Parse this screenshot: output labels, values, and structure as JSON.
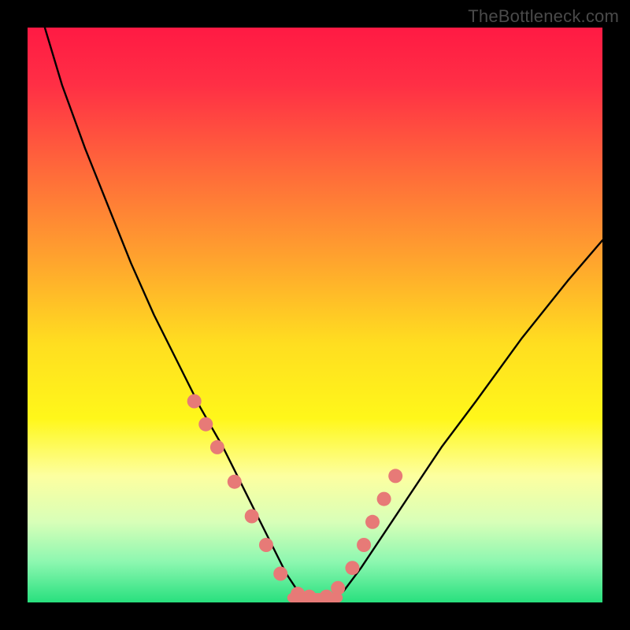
{
  "watermark": "TheBottleneck.com",
  "chart_data": {
    "type": "line",
    "title": "",
    "xlabel": "",
    "ylabel": "",
    "xlim": [
      0,
      100
    ],
    "ylim": [
      0,
      100
    ],
    "grid": false,
    "legend": false,
    "background_gradient": {
      "stops": [
        {
          "offset": 0.0,
          "color": "#ff1a44"
        },
        {
          "offset": 0.1,
          "color": "#ff2f45"
        },
        {
          "offset": 0.25,
          "color": "#ff6a3a"
        },
        {
          "offset": 0.4,
          "color": "#ffa22e"
        },
        {
          "offset": 0.55,
          "color": "#ffde20"
        },
        {
          "offset": 0.68,
          "color": "#fff71a"
        },
        {
          "offset": 0.78,
          "color": "#fdffa0"
        },
        {
          "offset": 0.86,
          "color": "#d8ffb8"
        },
        {
          "offset": 0.93,
          "color": "#8cf7b0"
        },
        {
          "offset": 1.0,
          "color": "#28e07e"
        }
      ]
    },
    "series": [
      {
        "name": "bottleneck-curve",
        "stroke": "#000000",
        "type": "line",
        "x": [
          3,
          6,
          10,
          14,
          18,
          22,
          26,
          30,
          34,
          37,
          40,
          42.5,
          45,
          47,
          49,
          53,
          55,
          58,
          62,
          66,
          72,
          78,
          86,
          94,
          100
        ],
        "y": [
          100,
          90,
          79,
          69,
          59,
          50,
          42,
          34,
          27,
          21,
          15,
          10,
          5,
          2,
          0.5,
          0.5,
          2,
          6,
          12,
          18,
          27,
          35,
          46,
          56,
          63
        ]
      },
      {
        "name": "curve-markers",
        "type": "scatter",
        "marker_color": "#e77a77",
        "marker_radius": 9,
        "x": [
          29,
          31,
          33,
          36,
          39,
          41.5,
          44,
          47,
          49,
          52,
          54,
          56.5,
          58.5,
          60,
          62,
          64
        ],
        "y": [
          35,
          31,
          27,
          21,
          15,
          10,
          5,
          1.5,
          1,
          1,
          2.5,
          6,
          10,
          14,
          18,
          22
        ]
      },
      {
        "name": "floor-segment",
        "type": "line",
        "stroke": "#e77a77",
        "stroke_width": 12,
        "x": [
          46,
          54
        ],
        "y": [
          0.8,
          0.8
        ]
      }
    ]
  }
}
